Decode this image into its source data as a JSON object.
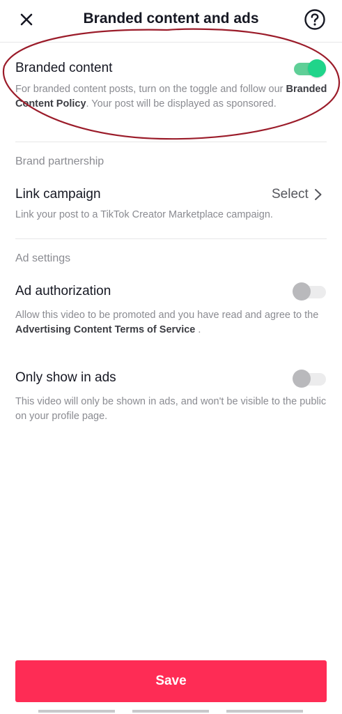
{
  "header": {
    "title": "Branded content and ads",
    "close_icon": "close-icon",
    "help_icon": "help-circle-icon"
  },
  "branded_content": {
    "title": "Branded content",
    "desc_prefix": "For branded content posts, turn on the toggle and follow our ",
    "policy_link": "Branded Content Policy",
    "desc_suffix": ". Your post will be displayed as sponsored.",
    "toggle_on": true
  },
  "brand_partnership": {
    "section_label": "Brand partnership",
    "link_campaign_title": "Link campaign",
    "select_label": "Select",
    "link_campaign_desc": "Link your post to a TikTok Creator Marketplace campaign."
  },
  "ad_settings": {
    "section_label": "Ad settings",
    "ad_authorization": {
      "title": "Ad authorization",
      "desc_prefix": "Allow this video to be promoted and you have read and agree to the ",
      "terms_link": "Advertising Content Terms of Service",
      "desc_suffix": " .",
      "toggle_on": false
    },
    "only_show_in_ads": {
      "title": "Only show in ads",
      "desc": "This video will only be shown in ads, and won't be visible to the public on your profile page.",
      "toggle_on": false
    }
  },
  "footer": {
    "save_label": "Save"
  },
  "colors": {
    "accent": "#fe2c55",
    "toggle_on": "#20d48a",
    "annotation": "#9b1c2a"
  }
}
